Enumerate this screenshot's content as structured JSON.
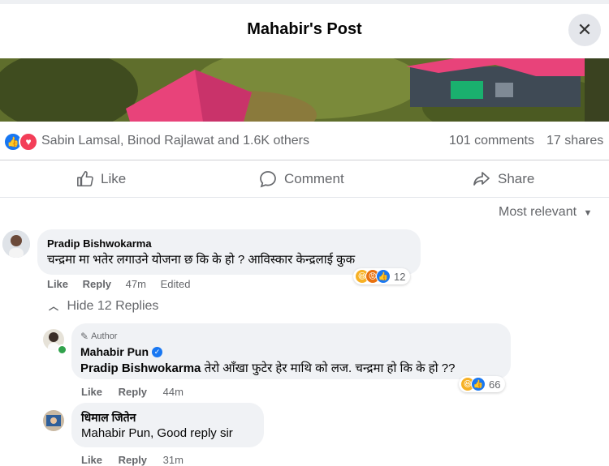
{
  "header": {
    "title": "Mahabir's Post",
    "close_icon": "close-icon"
  },
  "stats": {
    "reactions_text": "Sabin Lamsal, Binod Rajlawat and 1.6K others",
    "comments": "101 comments",
    "shares": "17 shares"
  },
  "actions": {
    "like": "Like",
    "comment": "Comment",
    "share": "Share"
  },
  "sort": {
    "label": "Most relevant"
  },
  "comments": [
    {
      "name": "Pradip Bishwokarma",
      "text": "चन्द्रमा मा भतेर लगाउने योजना छ कि के हो ? आविस्कार केन्द्रलाई कुक",
      "like": "Like",
      "reply": "Reply",
      "time": "47m",
      "edited": "Edited",
      "reaction_count": "12",
      "hide_replies": "Hide 12 Replies"
    },
    {
      "badge": "Author",
      "name": "Mahabir Pun",
      "mention": "Pradip Bishwokarma",
      "text": "तेरो आँखा फुटेर हेर माथि को लज. चन्द्रमा हो कि के हो ??",
      "like": "Like",
      "reply": "Reply",
      "time": "44m",
      "reaction_count": "66"
    },
    {
      "name": "धिमाल जितेन",
      "mention": "Mahabir Pun",
      "text": ", Good reply sir",
      "like": "Like",
      "reply": "Reply",
      "time": "31m"
    }
  ],
  "colors": {
    "accent": "#1877f2",
    "bubble": "#f0f2f5",
    "muted": "#65676b"
  }
}
